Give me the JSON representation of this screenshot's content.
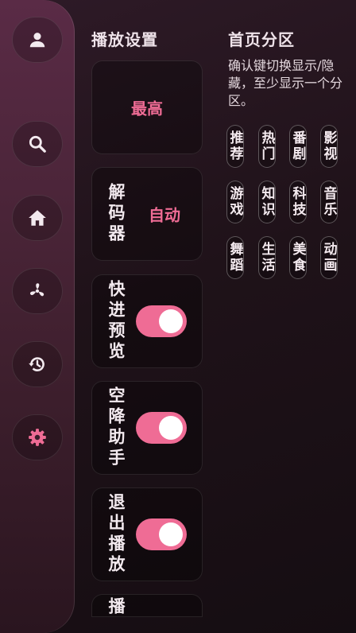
{
  "sidebar": {
    "items": [
      {
        "icon": "user-icon",
        "active": false
      },
      {
        "icon": "search-icon",
        "active": false
      },
      {
        "icon": "home-icon",
        "active": false
      },
      {
        "icon": "fan-icon",
        "active": false
      },
      {
        "icon": "history-icon",
        "active": false
      },
      {
        "icon": "gear-icon",
        "active": true
      }
    ],
    "icon_color": "#f3eaef",
    "active_color": "#ef6c95"
  },
  "playback": {
    "title": "播放设置",
    "quality": {
      "label": "",
      "value": "最高"
    },
    "decoder": {
      "label": "解码器",
      "value": "自动"
    },
    "fast_preview": {
      "label": "快进预览",
      "enabled": true
    },
    "airdrop": {
      "label": "空降助手",
      "enabled": true
    },
    "exit_play": {
      "label": "退出播放",
      "enabled": true
    },
    "next_item": {
      "label": "播"
    }
  },
  "home_sections": {
    "title": "首页分区",
    "description": "确认键切换显示/隐藏，至少显示一个分区。",
    "chips": [
      "推荐",
      "热门",
      "番剧",
      "影视",
      "游戏",
      "知识",
      "科技",
      "音乐",
      "舞蹈",
      "生活",
      "美食",
      "动画"
    ]
  },
  "colors": {
    "accent": "#ef6c95"
  }
}
